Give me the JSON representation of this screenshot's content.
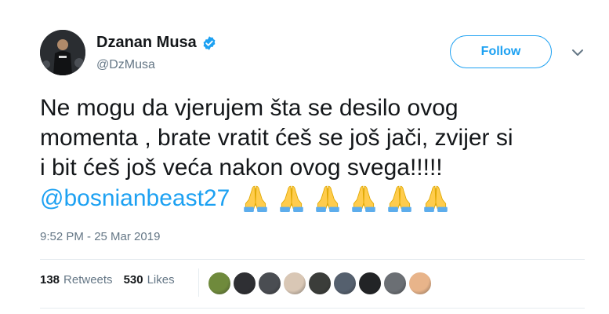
{
  "user": {
    "display_name": "Dzanan Musa",
    "handle": "@DzMusa",
    "verified_icon": "verified-badge-icon",
    "avatar_icon": "avatar"
  },
  "follow_label": "Follow",
  "tweet": {
    "lines": [
      "Ne mogu da vjerujem šta se desilo ovog",
      "momenta , brate vratit ćeš se još jači, zvijer si",
      "i bit ćeš još veća nakon ovog svega!!!!!"
    ],
    "mention": "@bosnianbeast27",
    "emoji": "folded-hands-icon",
    "emoji_count": 6
  },
  "timestamp": "9:52 PM - 25 Mar 2019",
  "stats": {
    "retweets_count": "138",
    "retweets_label": "Retweets",
    "likes_count": "530",
    "likes_label": "Likes"
  },
  "liker_colors": [
    "#6f8a3c",
    "#2e2f33",
    "#4a4d52",
    "#d9c7b5",
    "#3b3d3a",
    "#55606e",
    "#222426",
    "#6b6f74",
    "#e8b48a"
  ],
  "colors": {
    "accent": "#1da1f2",
    "text": "#14171a",
    "secondary": "#657786",
    "divider": "#e6ecf0"
  }
}
